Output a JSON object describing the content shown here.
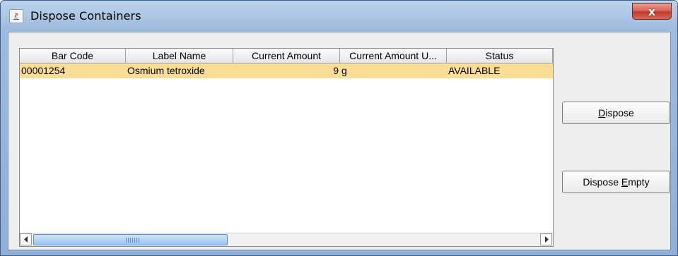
{
  "window": {
    "title": "Dispose Containers",
    "close_label": "x"
  },
  "table": {
    "columns": [
      "Bar Code",
      "Label Name",
      "Current Amount",
      "Current Amount U...",
      "Status"
    ],
    "rows": [
      {
        "bar_code": "00001254",
        "label_name": "Osmium tetroxide",
        "current_amount": "9",
        "current_amount_unit": "g",
        "status": "AVAILABLE"
      }
    ],
    "selected_row_color": "#fbdd96"
  },
  "buttons": {
    "dispose": {
      "mnemonic": "D",
      "rest": "ispose"
    },
    "dispose_empty": {
      "prefix": "Dispose ",
      "mnemonic": "E",
      "rest": "mpty"
    }
  }
}
